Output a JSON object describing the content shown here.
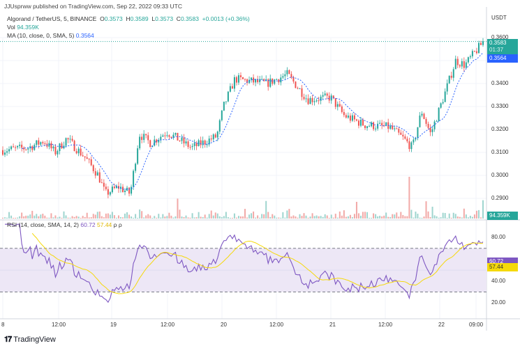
{
  "publish_line": "JJUsprww published on TradingView.com, Sep 22, 2022 09:33 UTC",
  "legend": {
    "symbol": "Algorand / TetherUS, 5, BINANCE",
    "o_label": "O",
    "o": "0.3573",
    "h_label": "H",
    "h": "0.3589",
    "l_label": "L",
    "l": "0.3573",
    "c_label": "C",
    "c": "0.3583",
    "change": "+0.0013 (+0.36%)",
    "vol_label": "Vol",
    "vol": "94.359K",
    "ma_label": "MA (10, close, 0, SMA, 5)",
    "ma": "0.3564",
    "rsi_label": "RSI (14, close, SMA, 14, 2)",
    "rsi": "60.72",
    "rsi_ma": "57.44",
    "rsi_extra": "ρ ρ"
  },
  "price_axis": {
    "currency": "USDT",
    "ticks": [
      "0.3600",
      "0.3500",
      "0.3400",
      "0.3300",
      "0.3200",
      "0.3100",
      "0.3000",
      "0.2900"
    ]
  },
  "tags": {
    "price": "0.3583",
    "countdown": "01:37",
    "ma": "0.3564",
    "volume": "94.359K",
    "rsi": "60.72",
    "rsi_ma": "57.44"
  },
  "rsi_axis": {
    "ticks": [
      "80.00",
      "40.00",
      "20.00"
    ]
  },
  "time_axis": [
    "8",
    "12:00",
    "19",
    "12:00",
    "20",
    "12:00",
    "21",
    "12:00",
    "22",
    "09:00"
  ],
  "footer": "TradingView",
  "colors": {
    "up": "#26a69a",
    "down": "#ef5350",
    "ma": "#2962ff",
    "rsi": "#7e57c2",
    "rsi_ma": "#f5d90a",
    "band": "#ede7f6"
  },
  "chart_data": {
    "type": "candlestick",
    "title": "Algorand / TetherUS, 5, BINANCE",
    "ylabel": "USDT",
    "ylim": [
      0.2865,
      0.362
    ],
    "price_keypoints_hours": [
      [
        0,
        0.311
      ],
      [
        11,
        0.312
      ],
      [
        18,
        0.315
      ],
      [
        23,
        0.31
      ],
      [
        28,
        0.316
      ],
      [
        36,
        0.308
      ],
      [
        42,
        0.3
      ],
      [
        45,
        0.292
      ],
      [
        51,
        0.295
      ],
      [
        56,
        0.292
      ],
      [
        60,
        0.318
      ],
      [
        65,
        0.314
      ],
      [
        72,
        0.319
      ],
      [
        83,
        0.312
      ],
      [
        94,
        0.317
      ],
      [
        97,
        0.33
      ],
      [
        102,
        0.342
      ],
      [
        116,
        0.34
      ],
      [
        125,
        0.344
      ],
      [
        134,
        0.333
      ],
      [
        144,
        0.334
      ],
      [
        150,
        0.326
      ],
      [
        159,
        0.322
      ],
      [
        170,
        0.321
      ],
      [
        176,
        0.316
      ],
      [
        180,
        0.312
      ],
      [
        184,
        0.328
      ],
      [
        188,
        0.318
      ],
      [
        194,
        0.335
      ],
      [
        199,
        0.35
      ],
      [
        203,
        0.348
      ],
      [
        211,
        0.358
      ]
    ],
    "rsi": {
      "period": 14,
      "ma_period": 14,
      "upper_band": 70,
      "lower_band": 30,
      "ylim": [
        5,
        95
      ]
    }
  }
}
